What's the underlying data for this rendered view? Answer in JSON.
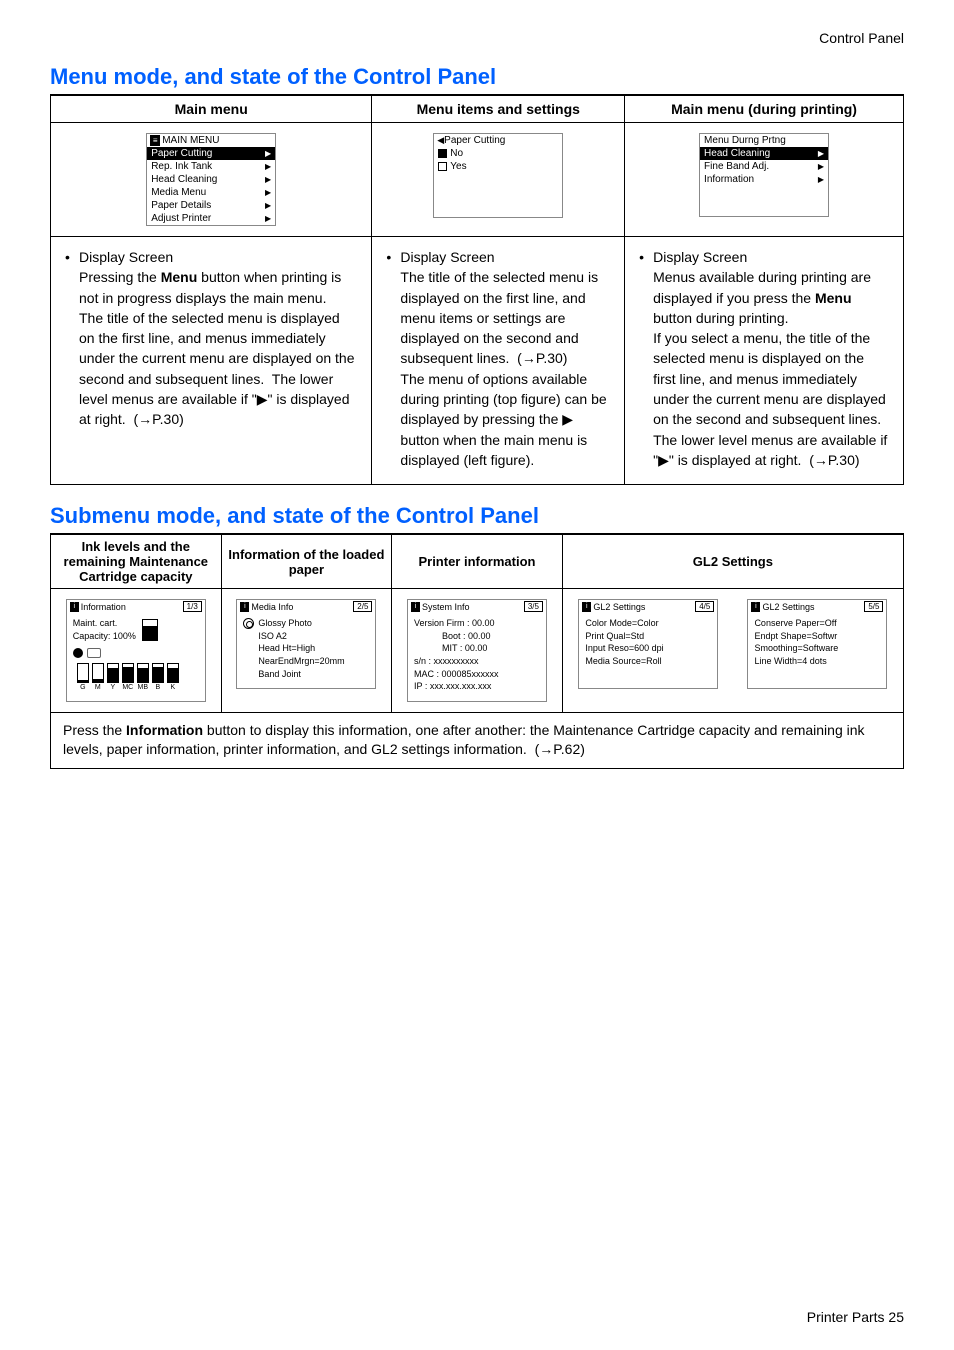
{
  "page_header": "Control Panel",
  "footer": "Printer Parts  25",
  "section1": {
    "heading": "Menu mode, and state of the Control Panel",
    "col_headers": [
      "Main menu",
      "Menu items and settings",
      "Main menu (during printing)"
    ],
    "panel1": {
      "title": "MAIN MENU",
      "items": [
        "Paper Cutting",
        "Rep. Ink Tank",
        "Head Cleaning",
        "Media Menu",
        "Paper Details",
        "Adjust Printer"
      ]
    },
    "panel2": {
      "title": "Paper Cutting",
      "options": [
        "No",
        "Yes"
      ]
    },
    "panel3": {
      "title": "Menu Durng Prtng",
      "items": [
        "Head Cleaning",
        "Fine Band Adj.",
        "Information"
      ]
    },
    "desc1_title": "Display Screen",
    "desc1_body": "Pressing the Menu button when printing is not in progress displays the main menu.\nThe title of the selected menu is displayed on the first line, and menus immediately under the current menu are displayed on the second and subsequent lines.  The lower level menus are available if \"▶\" is displayed at right.  (→P.30)",
    "desc2_title": "Display Screen",
    "desc2_body": "The title of the selected menu is displayed on the first line, and menu items or settings are displayed on the second and subsequent lines.  (→P.30)\nThe menu of options available during printing (top figure) can be displayed by pressing the ▶ button when the main menu is displayed (left figure).",
    "desc3_title": "Display Screen",
    "desc3_body": "Menus available during printing are displayed if you press the Menu button during printing.\nIf you select a menu, the title of the selected menu is displayed on the first line, and menus immediately under the current menu are displayed on the second and subsequent lines.\nThe lower level menus are available if \"▶\" is displayed at right.  (→P.30)"
  },
  "section2": {
    "heading": "Submenu mode, and state of the Control Panel",
    "headers": [
      "Ink levels and the remaining Maintenance Cartridge capacity",
      "Information of the loaded paper",
      "Printer information",
      "GL2 Settings"
    ],
    "panel_ink": {
      "title": "Information",
      "page": "1/3",
      "line1a": "Maint. cart.",
      "line1b": "Capacity: 100%",
      "tanks_labels": [
        "G",
        "M",
        "Y",
        "MC",
        "MB",
        "B",
        "K"
      ]
    },
    "panel_media": {
      "title": "Media Info",
      "page": "2/5",
      "rows": [
        "Glossy Photo",
        "ISO A2",
        "Head Ht=High",
        "NearEndMrgn=20mm",
        "Band Joint"
      ]
    },
    "panel_system": {
      "title": "System Info",
      "page": "3/5",
      "rows": [
        "Version Firm : 00.00",
        "Boot : 00.00",
        "MIT  : 00.00",
        "s/n :   xxxxxxxxxx",
        "MAC :  000085xxxxxx",
        "IP :    xxx.xxx.xxx.xxx"
      ]
    },
    "panel_gl2a": {
      "title": "GL2 Settings",
      "page": "4/5",
      "rows": [
        "Color Mode=Color",
        "Print Qual=Std",
        "Input Reso=600 dpi",
        "Media Source=Roll"
      ]
    },
    "panel_gl2b": {
      "title": "GL2 Settings",
      "page": "5/5",
      "rows": [
        "Conserve Paper=Off",
        "Endpt Shape=Softwr",
        "Smoothing=Software",
        "Line Width=4 dots"
      ]
    },
    "footer_text": "Press the Information button to display this information, one after another: the Maintenance Cartridge capacity and remaining ink levels, paper information, printer information, and GL2 settings information.  (→P.62)"
  }
}
